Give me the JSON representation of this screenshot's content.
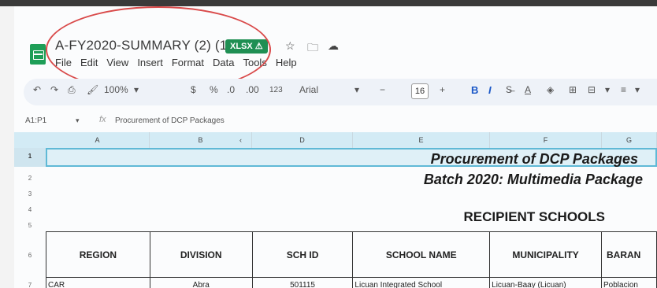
{
  "header": {
    "title": "A-FY2020-SUMMARY (2) (1)",
    "badge": "XLSX ⚠",
    "menu": [
      "File",
      "Edit",
      "View",
      "Insert",
      "Format",
      "Data",
      "Tools",
      "Help"
    ]
  },
  "toolbar": {
    "zoom": "100%",
    "currency": "$",
    "percent": "%",
    "dec_decrease": ".0",
    "dec_increase": ".00",
    "number_format": "123",
    "font": "Arial",
    "font_size": "16",
    "bold": "B",
    "italic": "I"
  },
  "formula_bar": {
    "name_box": "A1:P1",
    "fx": "fx",
    "content": "Procurement of DCP Packages"
  },
  "grid": {
    "columns": [
      "A",
      "B",
      "‹ ›",
      "D",
      "E",
      "F",
      "G"
    ],
    "row_numbers": [
      "1",
      "2",
      "3",
      "4",
      "5",
      "6",
      "7"
    ],
    "titles": {
      "line1": "Procurement of DCP Packages",
      "line2": "Batch 2020: Multimedia Package",
      "line3": "RECIPIENT SCHOOLS"
    },
    "table_headers": [
      "REGION",
      "DIVISION",
      "SCH ID",
      "SCHOOL NAME",
      "MUNICIPALITY",
      "BARAN"
    ],
    "rows": [
      [
        "CAR",
        "Abra",
        "501115",
        "Licuan Integrated School",
        "Licuan-Baay (Licuan)",
        "Poblacion"
      ]
    ]
  }
}
